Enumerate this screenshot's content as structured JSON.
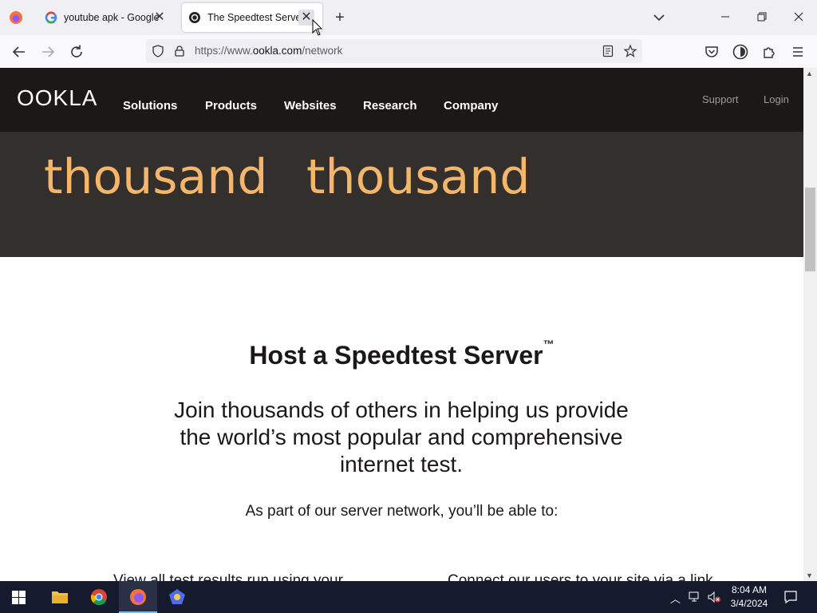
{
  "browser": {
    "tabs": [
      {
        "title": "youtube apk - Google ✕",
        "label": "youtube apk - Google Se"
      },
      {
        "label": "The Speedtest Server N"
      }
    ],
    "url_prefix": "https://www.",
    "url_domain": "ookla.com",
    "url_path": "/network"
  },
  "site": {
    "logo": "OOKLA",
    "nav": [
      "Solutions",
      "Products",
      "Websites",
      "Research",
      "Company"
    ],
    "utility": [
      "Support",
      "Login"
    ]
  },
  "hero": {
    "stat1": "thousand",
    "stat2": "thousand"
  },
  "content": {
    "title": "Host a Speedtest Server",
    "title_tm": "™",
    "lead": "Join thousands of others in helping us provide the world’s most popular and comprehensive internet test.",
    "sub": "As part of our server network, you’ll be able to:",
    "item1_partial": "View all test results run using your",
    "item2_partial": "Connect our users to your site via a link"
  },
  "taskbar": {
    "time": "8:04 AM",
    "date": "3/4/2024"
  },
  "colors": {
    "accent_orange": "#f4b66a",
    "header_bg": "#1b1817",
    "strip_bg": "#332f2c"
  }
}
